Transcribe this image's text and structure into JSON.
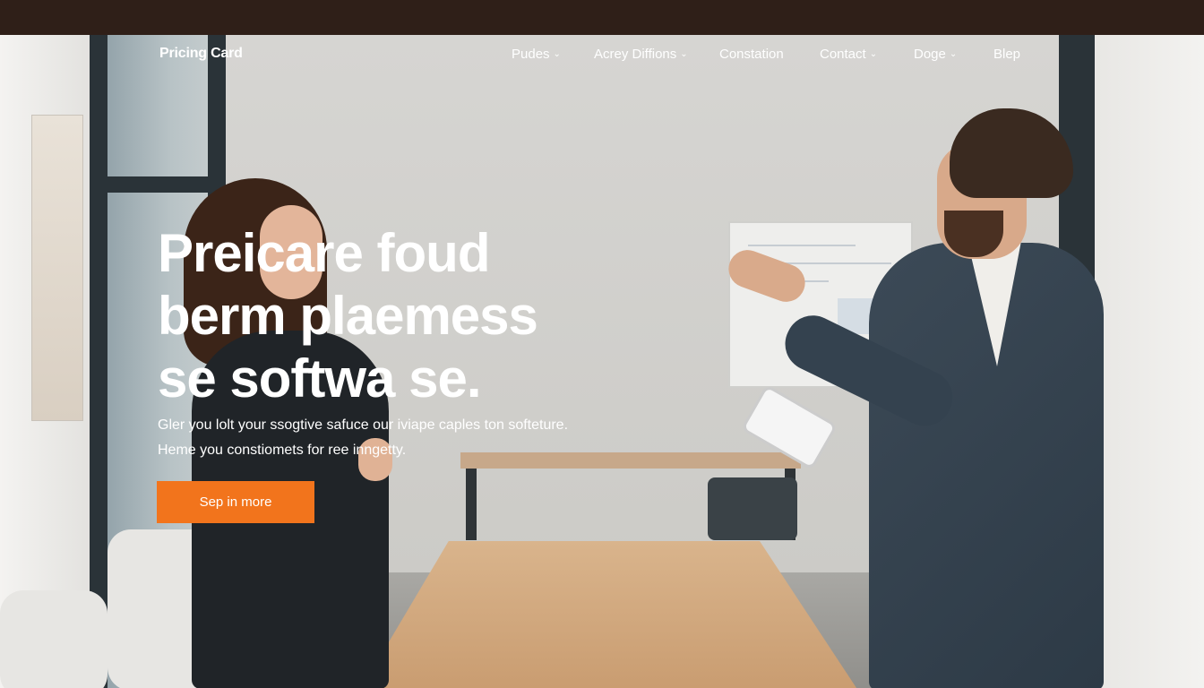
{
  "nav": {
    "brand": "Pricing Card",
    "items": [
      {
        "label": "Pudes",
        "chevron": "chevron-down-icon"
      },
      {
        "label": "Acrey Diffions",
        "chevron": "chevron-down-icon"
      },
      {
        "label": "Constation"
      },
      {
        "label": "Contact",
        "chevron": "chevron-down-icon"
      },
      {
        "label": "Doge",
        "chevron": "chevron-down-icon"
      },
      {
        "label": "Blep"
      }
    ]
  },
  "hero": {
    "lines": [
      "Preicare foud",
      "berm plaemess",
      "se softwa se."
    ],
    "subtitle_lines": [
      "Gler you lolt your ssogtive safuce our iviape caples ton softeture.",
      "Heme you constiomets for ree inngetty."
    ],
    "cta_label": "Sep in more"
  },
  "colors": {
    "topbar": "#2f1f18",
    "cta": "#f2741c",
    "text": "#ffffff"
  }
}
